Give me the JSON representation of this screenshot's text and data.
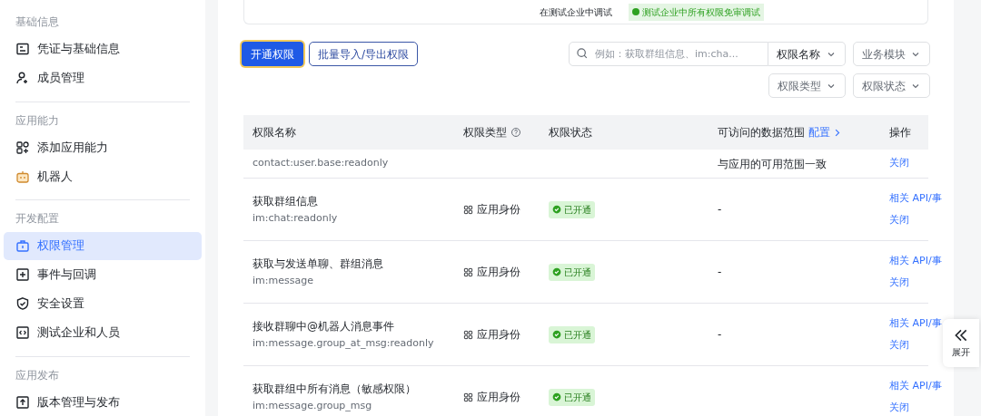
{
  "sidebar": {
    "sections": [
      {
        "title": "基础信息",
        "items": [
          {
            "label": "凭证与基础信息",
            "selected": false
          },
          {
            "label": "成员管理",
            "selected": false
          }
        ]
      },
      {
        "title": "应用能力",
        "items": [
          {
            "label": "添加应用能力",
            "selected": false
          },
          {
            "label": "机器人",
            "selected": false
          }
        ]
      },
      {
        "title": "开发配置",
        "items": [
          {
            "label": "权限管理",
            "selected": true
          },
          {
            "label": "事件与回调",
            "selected": false
          },
          {
            "label": "安全设置",
            "selected": false
          },
          {
            "label": "测试企业和人员",
            "selected": false
          }
        ]
      },
      {
        "title": "应用发布",
        "items": [
          {
            "label": "版本管理与发布",
            "selected": false
          }
        ]
      }
    ]
  },
  "banner": {
    "step": "在测试企业中调试",
    "badge": "测试企业中所有权限免审调试"
  },
  "toolbar": {
    "primary_button": "开通权限",
    "secondary_button": "批量导入/导出权限",
    "search": {
      "placeholder": "例如：获取群组信息、im:cha..."
    },
    "search_scope": "权限名称",
    "filters": [
      "业务模块",
      "权限类型",
      "权限状态"
    ]
  },
  "table": {
    "columns": [
      "权限名称",
      "权限类型",
      "权限状态",
      "可访问的数据范围",
      "操作"
    ],
    "scope_link": "配置",
    "rows": [
      {
        "scope": "contact:user.base:readonly",
        "data_range": "与应用的可用范围一致",
        "actions": [
          "关闭"
        ]
      },
      {
        "name": "获取群组信息",
        "scope": "im:chat:readonly",
        "type": "应用身份",
        "status": "已开通",
        "data_range": "-",
        "actions": [
          "相关 API/事",
          "关闭"
        ]
      },
      {
        "name": "获取与发送单聊、群组消息",
        "scope": "im:message",
        "type": "应用身份",
        "status": "已开通",
        "data_range": "-",
        "actions": [
          "相关 API/事",
          "关闭"
        ]
      },
      {
        "name": "接收群聊中@机器人消息事件",
        "scope": "im:message.group_at_msg:readonly",
        "type": "应用身份",
        "status": "已开通",
        "data_range": "-",
        "actions": [
          "相关 API/事",
          "关闭"
        ]
      },
      {
        "name": "获取群组中所有消息（敏感权限）",
        "scope": "im:message.group_msg",
        "type": "应用身份",
        "status": "已开通",
        "actions": [
          "相关 API/事",
          "关闭"
        ]
      }
    ]
  },
  "side_toggle": {
    "label": "展开"
  }
}
